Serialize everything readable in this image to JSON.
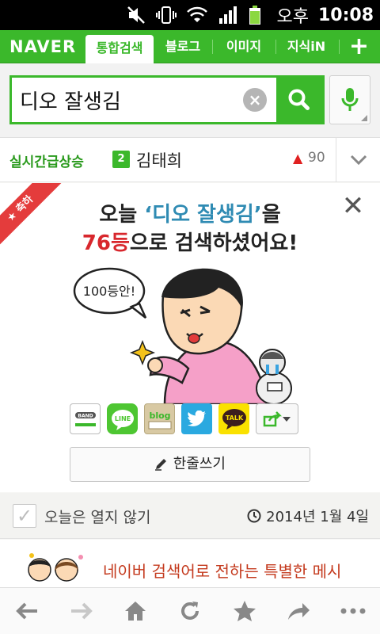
{
  "status_bar": {
    "ampm": "오후",
    "time": "10:08",
    "icons": [
      "mute-icon",
      "vibrate-icon",
      "wifi-icon",
      "signal-icon",
      "battery-icon"
    ]
  },
  "tab_bar": {
    "logo": "NAVER",
    "tabs": [
      {
        "label": "통합검색",
        "active": true
      },
      {
        "label": "블로그",
        "active": false
      },
      {
        "label": "이미지",
        "active": false
      },
      {
        "label": "지식iN",
        "active": false
      }
    ],
    "add_tab_label": "+"
  },
  "search": {
    "value": "디오 잘생김",
    "clear_label": "×",
    "icons": [
      "search-icon",
      "mic-icon"
    ]
  },
  "trending": {
    "label": "실시간급상승",
    "rank": "2",
    "term": "김태희",
    "arrow": "▲",
    "count": "90"
  },
  "card": {
    "ribbon": "축하",
    "close_label": "✕",
    "line1_pre": "오늘 ",
    "line1_quote": "‘디오 잘생김’",
    "line1_post": "을",
    "line2_rank": "76등",
    "line2_post": "으로 검색하셨어요!",
    "bubble_text": "100등안!",
    "share_buttons": [
      {
        "name": "band",
        "label": "BAND"
      },
      {
        "name": "line",
        "label": "LINE"
      },
      {
        "name": "blog",
        "label": "blog"
      },
      {
        "name": "twitter",
        "label": ""
      },
      {
        "name": "kakaotalk",
        "label": "TALK"
      }
    ],
    "write_button": "한줄쓰기"
  },
  "footer": {
    "dont_open_today": "오늘은 열지 않기",
    "date": "2014년 1월 4일"
  },
  "message": {
    "text": "네이버 검색어로 전하는 특별한 메시"
  },
  "bottom_nav": [
    "back-icon",
    "forward-icon",
    "home-icon",
    "refresh-icon",
    "bookmark-star-icon",
    "share-icon",
    "more-icon"
  ],
  "colors": {
    "brand_green": "#3bb82b",
    "highlight_blue": "#2f8bb3",
    "rank_red": "#d8272d",
    "ribbon_red": "#e43c3c"
  }
}
